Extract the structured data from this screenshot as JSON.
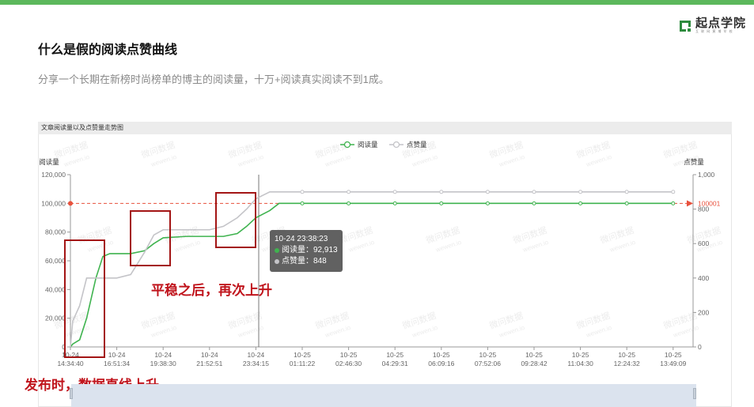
{
  "header": {
    "logo_main": "起点学院",
    "logo_sub": "互 联 网 黄 埔 军 校",
    "title": "什么是假的阅读点赞曲线",
    "subtitle": "分享一个长期在新榜时尚榜单的博主的阅读量，十万+阅读真实阅读不到1成。"
  },
  "chart_panel": {
    "header_text": "文章阅读量以及点赞量走势图",
    "watermark": "微问数据",
    "watermark_url": "wewen.io"
  },
  "annotations": {
    "rise_label": "发布时，数据直线上升",
    "plateau_label": "平稳之后，再次上升"
  },
  "tooltip": {
    "title": "10-24 23:38:23",
    "read_label": "阅读量：92,913",
    "like_label": "点赞量：848"
  },
  "colors": {
    "read_line": "#3fb34f",
    "like_line": "#c4c4c8",
    "markline": "#e8513d",
    "annot": "#c0141c"
  },
  "chart_data": {
    "type": "line",
    "legend": [
      "阅读量",
      "点赞量"
    ],
    "legend_position": "top-center",
    "y_left": {
      "label": "阅读量",
      "ticks": [
        "0",
        "20,000",
        "40,000",
        "60,000",
        "80,000",
        "100,000",
        "120,000"
      ],
      "range": [
        0,
        120000
      ]
    },
    "y_right": {
      "label": "点赞量",
      "ticks": [
        "0",
        "200",
        "400",
        "600",
        "800",
        "1,000"
      ],
      "range": [
        0,
        1000
      ]
    },
    "x_ticks": [
      [
        "10-24",
        "14:34:40"
      ],
      [
        "10-24",
        "16:51:34"
      ],
      [
        "10-24",
        "19:38:30"
      ],
      [
        "10-24",
        "21:52:51"
      ],
      [
        "10-24",
        "23:34:15"
      ],
      [
        "10-25",
        "01:11:22"
      ],
      [
        "10-25",
        "02:46:30"
      ],
      [
        "10-25",
        "04:29:31"
      ],
      [
        "10-25",
        "06:09:16"
      ],
      [
        "10-25",
        "07:52:06"
      ],
      [
        "10-25",
        "09:28:42"
      ],
      [
        "10-25",
        "11:04:30"
      ],
      [
        "10-25",
        "12:24:32"
      ],
      [
        "10-25",
        "13:49:09"
      ]
    ],
    "markline_label": "100001",
    "markline_value": 100001,
    "series": [
      {
        "name": "阅读量",
        "x": [
          0,
          0.05,
          0.2,
          0.35,
          0.55,
          0.7,
          0.85,
          1,
          1.3,
          1.6,
          1.8,
          2,
          2.5,
          3,
          3.3,
          3.6,
          3.8,
          4,
          4.3,
          4.5,
          5,
          6,
          7,
          8,
          9,
          10,
          11,
          12,
          13
        ],
        "values": [
          0,
          2000,
          5000,
          20000,
          48000,
          63000,
          65000,
          65000,
          65000,
          67000,
          72000,
          76000,
          77000,
          77000,
          77000,
          79000,
          84000,
          90000,
          95000,
          100001,
          100001,
          100001,
          100001,
          100001,
          100001,
          100001,
          100001,
          100001,
          100001
        ]
      },
      {
        "name": "点赞量",
        "x": [
          0,
          0.05,
          0.2,
          0.35,
          0.55,
          0.7,
          0.85,
          1,
          1.3,
          1.6,
          1.8,
          2,
          2.5,
          3,
          3.3,
          3.6,
          3.8,
          4,
          4.3,
          4.5,
          5,
          6,
          7,
          8,
          9,
          10,
          11,
          12,
          13
        ],
        "values": [
          0,
          150,
          240,
          400,
          400,
          400,
          400,
          400,
          420,
          550,
          650,
          680,
          680,
          680,
          700,
          750,
          800,
          860,
          900,
          900,
          900,
          900,
          900,
          900,
          900,
          900,
          900,
          900,
          900
        ]
      }
    ]
  }
}
